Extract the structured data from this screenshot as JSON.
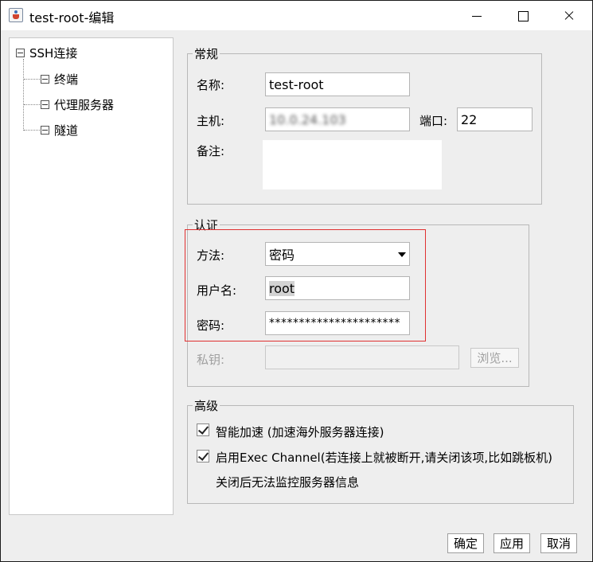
{
  "window": {
    "title": "test-root-编辑"
  },
  "tree": {
    "root": "SSH连接",
    "children": [
      "终端",
      "代理服务器",
      "隧道"
    ]
  },
  "general": {
    "legend": "常规",
    "name_label": "名称:",
    "name_value": "test-root",
    "host_label": "主机:",
    "host_value": "10.0.24.103",
    "port_label": "端口:",
    "port_value": "22",
    "note_label": "备注:",
    "note_value": ""
  },
  "auth": {
    "legend": "认证",
    "method_label": "方法:",
    "method_value": "密码",
    "user_label": "用户名:",
    "user_value": "root",
    "password_label": "密码:",
    "password_value": "**********************",
    "key_label": "私钥:",
    "key_value": "",
    "browse_label": "浏览..."
  },
  "advanced": {
    "legend": "高级",
    "accel_label": "智能加速 (加速海外服务器连接)",
    "accel_checked": true,
    "exec_label": "启用Exec Channel(若连接上就被断开,请关闭该项,比如跳板机)",
    "exec_checked": true,
    "exec_note": "关闭后无法监控服务器信息"
  },
  "footer": {
    "ok": "确定",
    "apply": "应用",
    "cancel": "取消"
  }
}
